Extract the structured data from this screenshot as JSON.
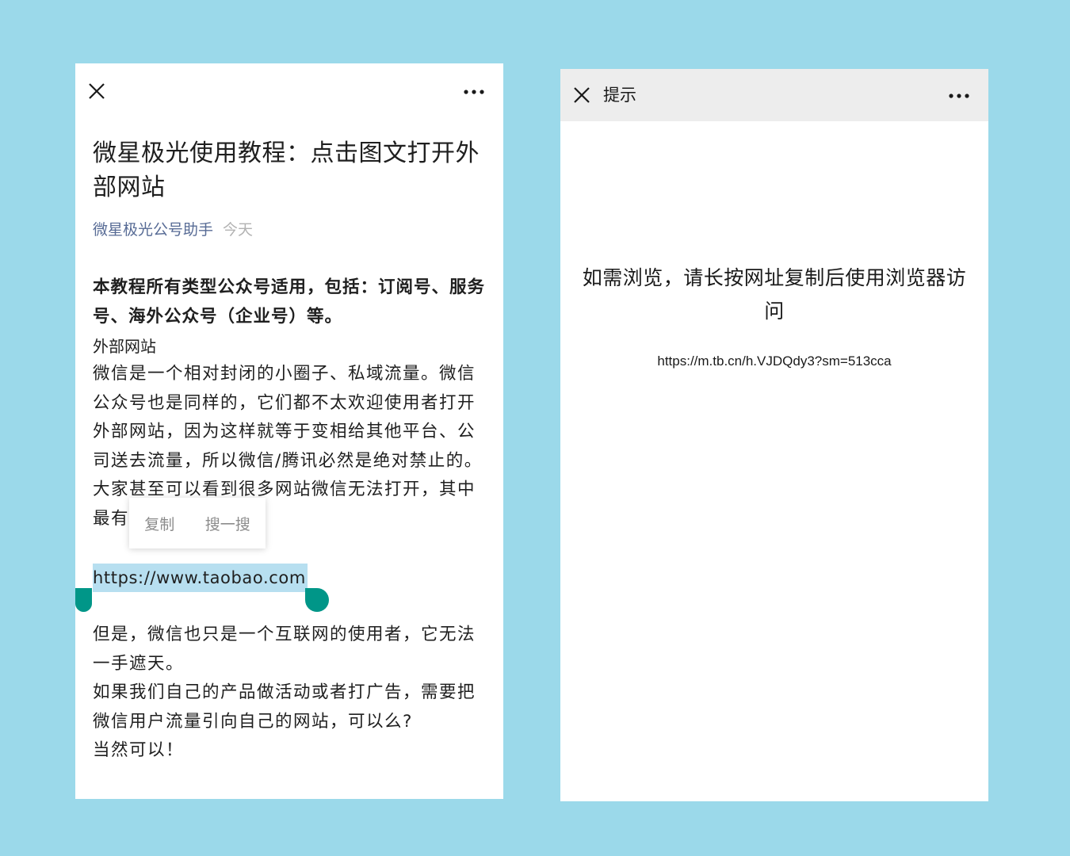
{
  "left_page": {
    "title": "微星极光使用教程：点击图文打开外部网站",
    "author": "微星极光公号助手",
    "date": "今天",
    "intro_bold": "本教程所有类型公众号适用，包括：订阅号、服务号、海外公众号（企业号）等。",
    "section_label": "外部网站",
    "paragraph1": "微信是一个相对封闭的小圈子、私域流量。微信公众号也是同样的，它们都不太欢迎使用者打开外部网站，因为这样就等于变相给其他平台、公司送去流量，所以微信/腾讯必然是绝对禁止的。大家甚至可以看到很多网站微信无法打开，其中最有名的非淘宝莫属。",
    "context_menu": {
      "copy": "复制",
      "search": "搜一搜"
    },
    "selected_url": "https://www.taobao.com",
    "paragraph2_lines": [
      "但是，微信也只是一个互联网的使用者，它无法一手遮天。",
      "如果我们自己的产品做活动或者打广告，需要把微信用户流量引向自己的网站，可以么?",
      "当然可以！"
    ]
  },
  "right_page": {
    "header_title": "提示",
    "notice": "如需浏览，请长按网址复制后使用浏览器访问",
    "url": "https://m.tb.cn/h.VJDQdy3?sm=513cca"
  },
  "icons": {
    "close": "close-icon",
    "more": "more-icon"
  },
  "colors": {
    "background": "#9bd9ea",
    "author_link": "#576b95",
    "selection": "#b7dff0",
    "handle": "#009688",
    "header_bar": "#ededed"
  }
}
